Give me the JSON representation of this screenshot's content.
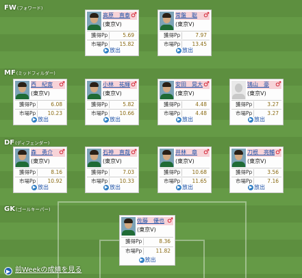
{
  "positions": {
    "fw": {
      "code": "FW",
      "sub": "(フォワード)"
    },
    "mf": {
      "code": "MF",
      "sub": "(ミッドフィルダー)"
    },
    "df": {
      "code": "DF",
      "sub": "(ディフェンダー)"
    },
    "gk": {
      "code": "GK",
      "sub": "(ゴールキーパー)"
    }
  },
  "labels": {
    "earned": "獲得Pp",
    "market": "市場Pp",
    "release": "放出",
    "gender_symbol": "♂"
  },
  "players": {
    "fw1": {
      "name": "高原　直泰",
      "team": "(東京V)",
      "earned": "5.69",
      "market": "15.82"
    },
    "fw2": {
      "name": "常盤　聡",
      "team": "(東京V)",
      "earned": "7.97",
      "market": "13.45"
    },
    "mf1": {
      "name": "西　紀寛",
      "team": "(東京V)",
      "earned": "6.08",
      "market": "10.23"
    },
    "mf2": {
      "name": "小林　祐輝",
      "team": "(東京V)",
      "earned": "5.82",
      "market": "10.66"
    },
    "mf3": {
      "name": "安田　晃大",
      "team": "(東京V)",
      "earned": "4.48",
      "market": "4.48"
    },
    "mf4": {
      "name": "鴇山　豪",
      "team": "(東京V)",
      "earned": "3.27",
      "market": "3.27"
    },
    "df1": {
      "name": "森　勇介",
      "team": "(東京V)",
      "earned": "8.16",
      "market": "10.92"
    },
    "df2": {
      "name": "石神　直哉",
      "team": "(東京V)",
      "earned": "7.03",
      "market": "10.33"
    },
    "df3": {
      "name": "井林　章",
      "team": "(東京V)",
      "earned": "10.68",
      "market": "11.65"
    },
    "df4": {
      "name": "刀根　亮輔",
      "team": "(東京V)",
      "earned": "3.56",
      "market": "7.16"
    },
    "gk1": {
      "name": "佐藤　優也",
      "team": "(東京V)",
      "earned": "8.36",
      "market": "11.82"
    }
  },
  "footer": {
    "link": "前Weekの成績を見る"
  },
  "colors": {
    "pitch_dark": "#5d8f3f",
    "pitch_light": "#659a46",
    "name_bg": "#f7d3d8",
    "link": "#1e52a8",
    "value": "#8a6a12",
    "gender": "#d01b2a"
  },
  "icons": {
    "release": "right-arrow-circle-icon",
    "footer": "right-arrow-circle-icon"
  }
}
